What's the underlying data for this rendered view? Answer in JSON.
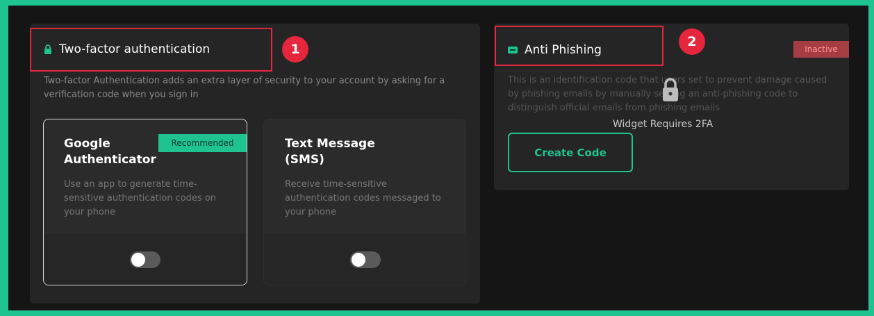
{
  "two_factor": {
    "title": "Two-factor authentication",
    "badge_number": "1",
    "description": "Two-factor Authentication adds an extra layer of security to your account by asking for a verification code when you sign in",
    "methods": [
      {
        "title_line1": "Google",
        "title_line2": "Authenticator",
        "tag": "Recommended",
        "description": "Use an app to generate time-sensitive authentication codes on your phone",
        "enabled": false
      },
      {
        "title_line1": "Text Message",
        "title_line2": "(SMS)",
        "description": "Receive time-sensitive authentication codes messaged to your phone",
        "enabled": false
      }
    ]
  },
  "anti_phishing": {
    "title": "Anti Phishing",
    "badge_number": "2",
    "status": "Inactive",
    "description": "This is an identification code that users set to prevent damage caused by phishing emails by manually setting an anti-phishing code to distinguish official emails from phishing emails",
    "lock_message": "Widget Requires 2FA",
    "create_button_label": "Create Code"
  },
  "colors": {
    "accent": "#1ec38f",
    "annotation_red": "#e6263c",
    "inactive_bg": "#a53d43"
  },
  "icons": [
    "lock-icon",
    "code-icon",
    "lock-overlay-icon",
    "toggle-switch"
  ]
}
